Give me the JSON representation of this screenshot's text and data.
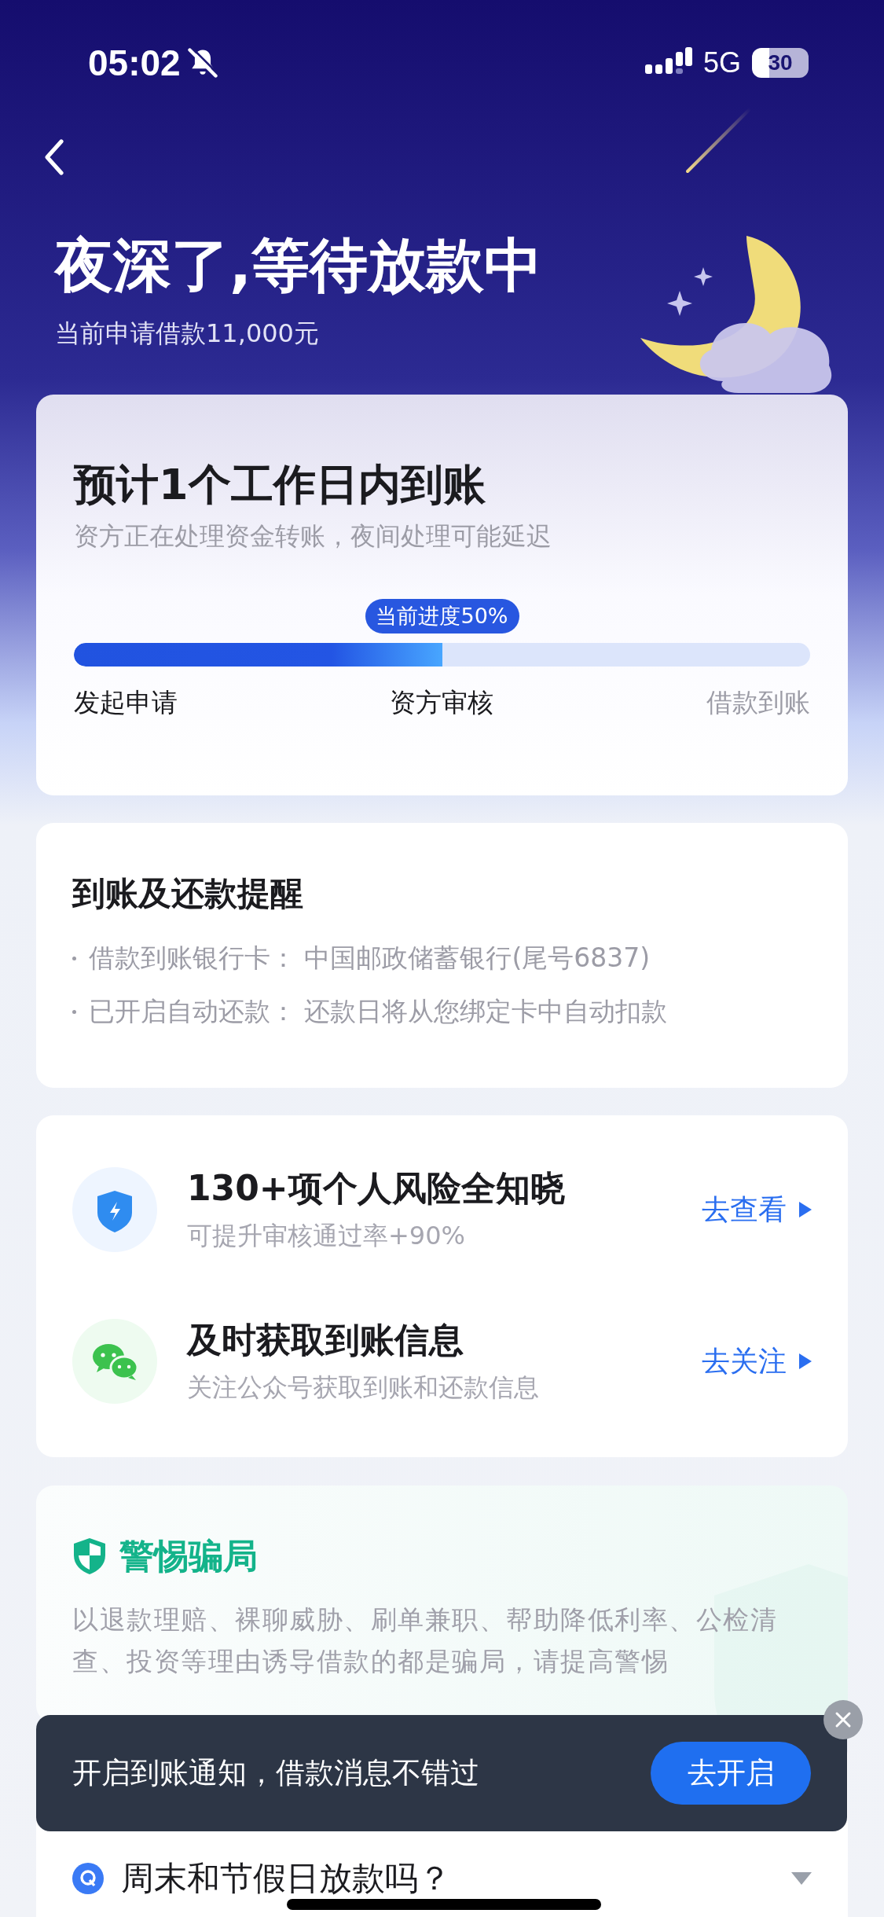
{
  "status_bar": {
    "time": "05:02",
    "network": "5G",
    "battery": "30"
  },
  "header": {
    "title": "夜深了,等待放款中",
    "subtitle": "当前申请借款11,000元"
  },
  "progress_card": {
    "title": "预计1个工作日内到账",
    "subtitle": "资方正在处理资金转账，夜间处理可能延迟",
    "badge": "当前进度50%",
    "level": 0.5,
    "steps": [
      {
        "label": "发起申请",
        "reached": true
      },
      {
        "label": "资方审核",
        "reached": true
      },
      {
        "label": "借款到账",
        "reached": false
      }
    ]
  },
  "reminder": {
    "title": "到账及还款提醒",
    "items": [
      {
        "text": "借款到账银行卡： 中国邮政储蓄银行(尾号6837)"
      },
      {
        "text": "已开启自动还款： 还款日将从您绑定卡中自动扣款"
      }
    ]
  },
  "services": [
    {
      "kind": "shield",
      "title": "130+项个人风险全知晓",
      "subtitle": "可提升审核通过率+90%",
      "action": "去查看"
    },
    {
      "kind": "chat",
      "title": "及时获取到账信息",
      "subtitle": "关注公众号获取到账和还款信息",
      "action": "去关注"
    }
  ],
  "warning": {
    "title": "警惕骗局",
    "text": "以退款理赔、裸聊威胁、刷单兼职、帮助降低利率、公检清查、投资等理由诱导借款的都是骗局，请提高警惕"
  },
  "faq": {
    "items": [
      {
        "question": "周末和节假日放款吗？"
      }
    ]
  },
  "toast": {
    "text": "开启到账通知，借款消息不错过",
    "button": "去开启"
  }
}
